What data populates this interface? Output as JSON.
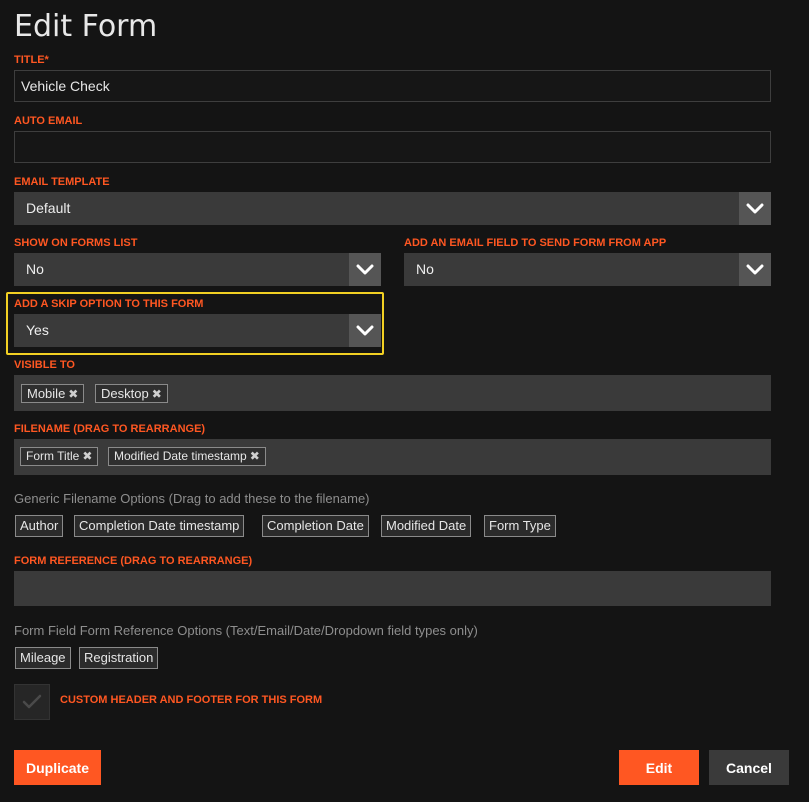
{
  "page_title": "Edit Form",
  "fields": {
    "title": {
      "label": "TITLE*",
      "value": "Vehicle Check"
    },
    "auto_email": {
      "label": "AUTO EMAIL",
      "value": ""
    },
    "email_template": {
      "label": "EMAIL TEMPLATE",
      "value": "Default"
    },
    "show_on_forms_list": {
      "label": "SHOW ON FORMS LIST",
      "value": "No"
    },
    "add_email_field": {
      "label": "ADD AN EMAIL FIELD TO SEND FORM FROM APP",
      "value": "No"
    },
    "skip_option": {
      "label": "ADD A SKIP OPTION TO THIS FORM",
      "value": "Yes"
    },
    "visible_to": {
      "label": "VISIBLE TO",
      "tags": [
        "Mobile",
        "Desktop"
      ]
    },
    "filename": {
      "label": "FILENAME (DRAG TO REARRANGE)",
      "tags": [
        "Form Title",
        "Modified Date timestamp"
      ]
    },
    "form_reference": {
      "label": "FORM REFERENCE (DRAG TO REARRANGE)",
      "tags": []
    }
  },
  "generic_filename_options": {
    "hint": "Generic Filename Options (Drag to add these to the filename)",
    "chips": [
      "Author",
      "Completion Date timestamp",
      "Completion Date",
      "Modified Date",
      "Form Type"
    ]
  },
  "form_reference_options": {
    "hint": "Form Field Form Reference Options (Text/Email/Date/Dropdown field types only)",
    "chips": [
      "Mileage",
      "Registration"
    ]
  },
  "custom_header_footer": {
    "label": "CUSTOM HEADER AND FOOTER FOR THIS FORM",
    "checked": false
  },
  "buttons": {
    "duplicate": "Duplicate",
    "edit": "Edit",
    "cancel": "Cancel"
  },
  "tag_remove_glyph": "✖",
  "colors": {
    "accent": "#ff5722",
    "highlight": "#f2d023",
    "background": "#141414"
  }
}
